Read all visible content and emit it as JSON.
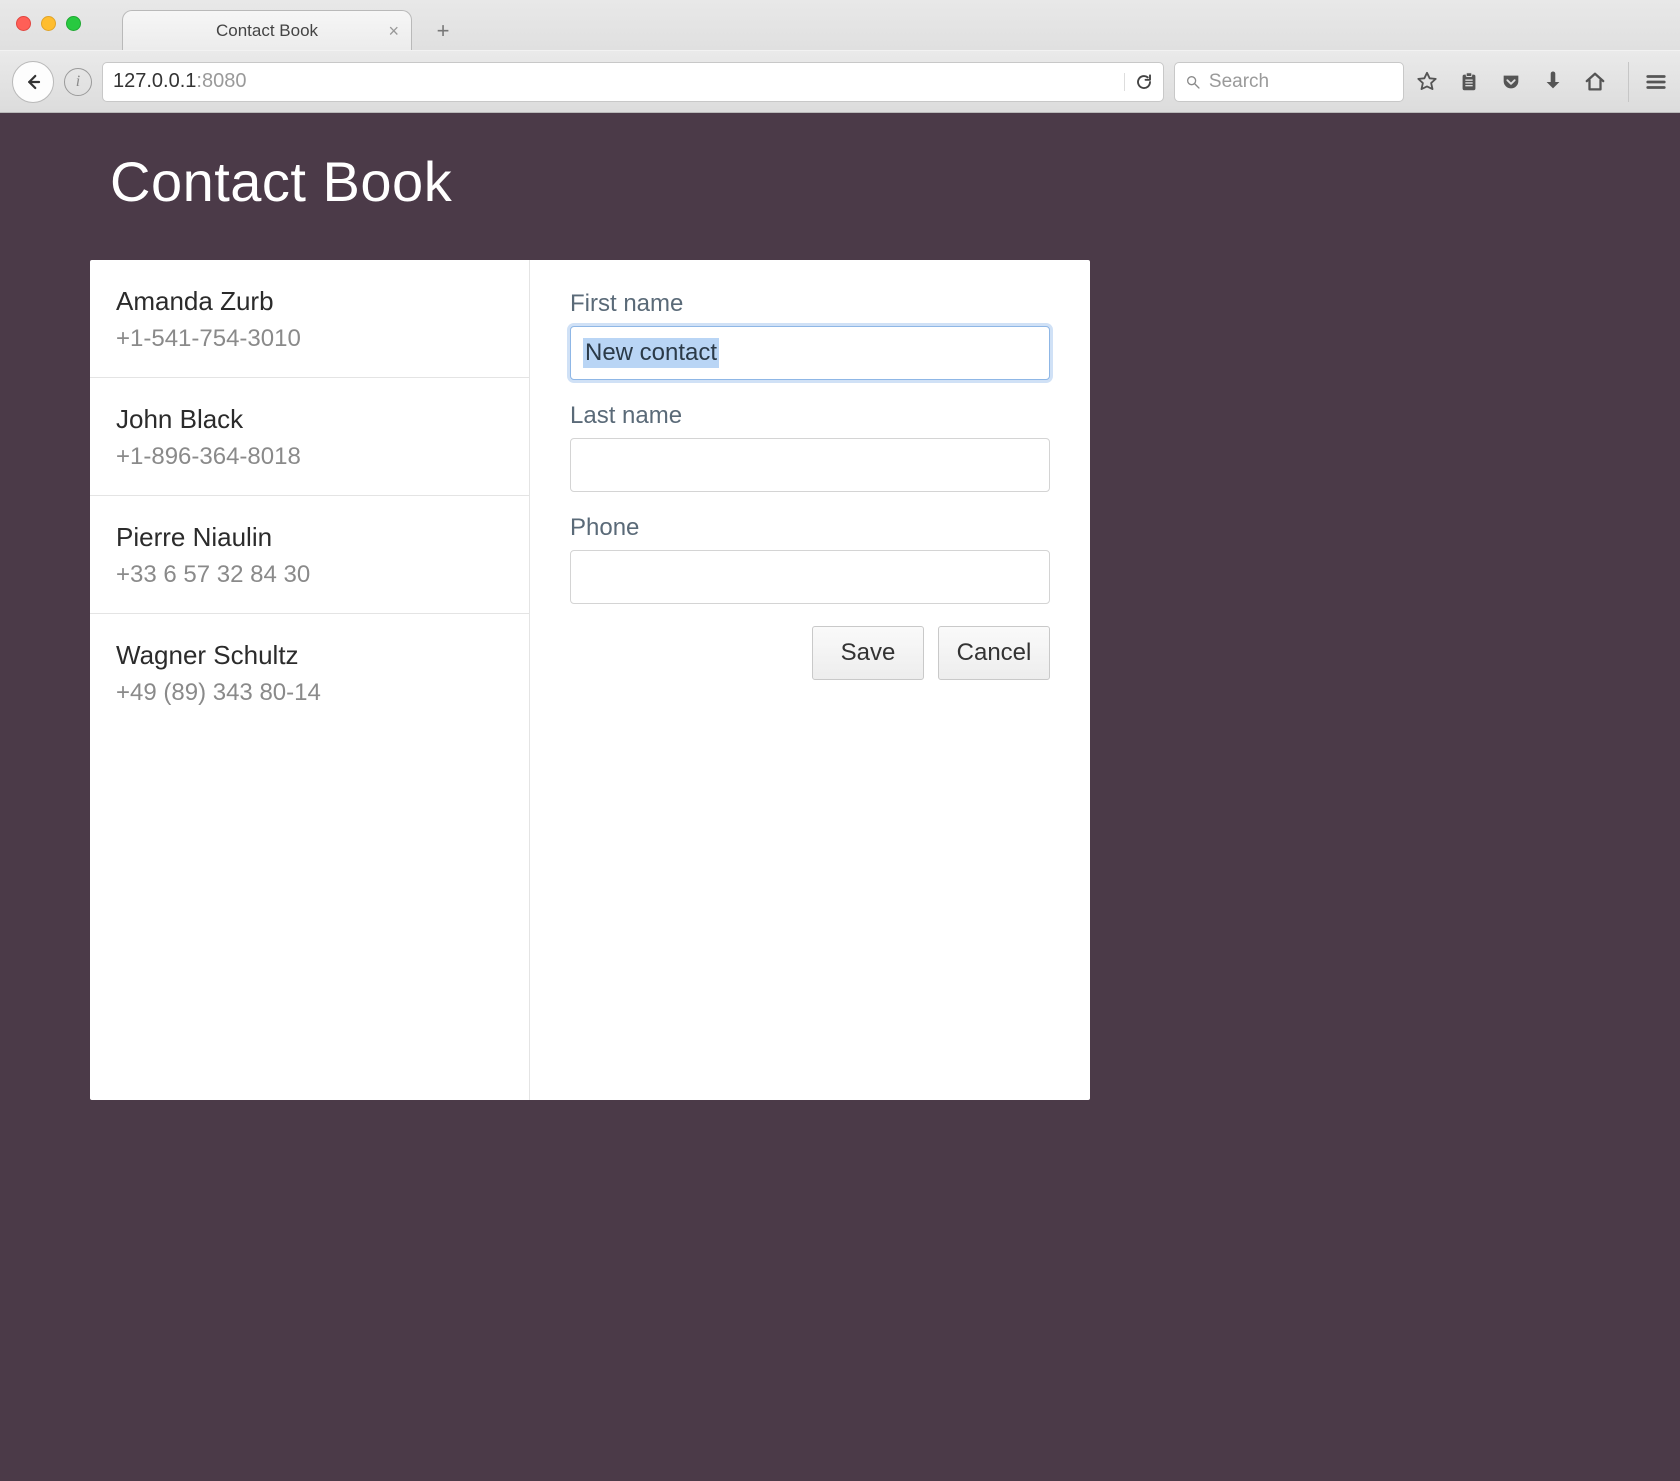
{
  "browser": {
    "tab_title": "Contact Book",
    "url_host": "127.0.0.1",
    "url_port": ":8080",
    "search_placeholder": "Search"
  },
  "page": {
    "title": "Contact Book"
  },
  "contacts": [
    {
      "name": "Amanda Zurb",
      "phone": "+1-541-754-3010"
    },
    {
      "name": "John Black",
      "phone": "+1-896-364-8018"
    },
    {
      "name": "Pierre Niaulin",
      "phone": "+33 6 57 32 84 30"
    },
    {
      "name": "Wagner Schultz",
      "phone": "+49 (89) 343 80-14"
    }
  ],
  "form": {
    "first_name_label": "First name",
    "first_name_value": "New contact",
    "last_name_label": "Last name",
    "last_name_value": "",
    "phone_label": "Phone",
    "phone_value": "",
    "save_label": "Save",
    "cancel_label": "Cancel"
  }
}
